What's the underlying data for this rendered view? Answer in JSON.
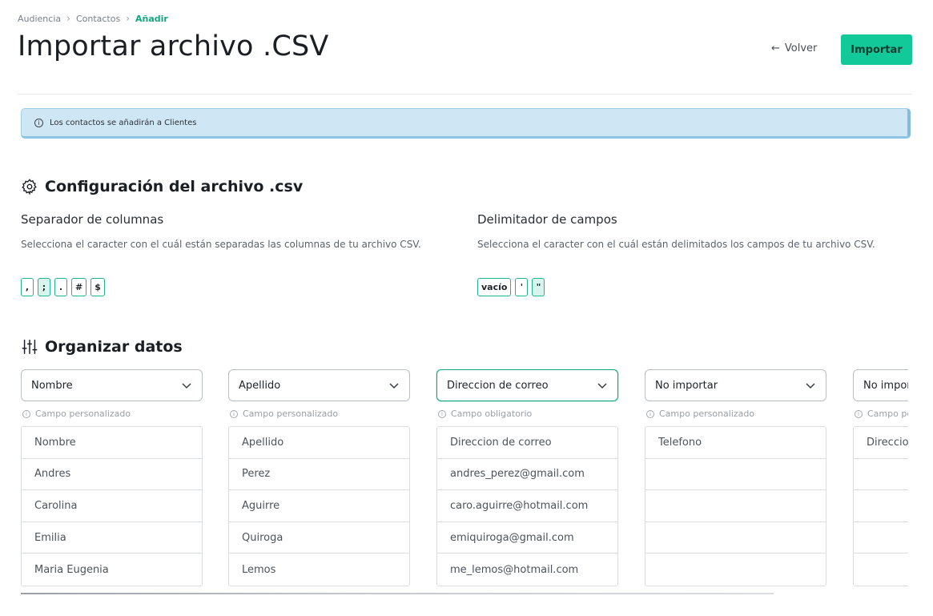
{
  "breadcrumb": [
    "Audiencia",
    "Contactos",
    "Añadir"
  ],
  "page_title": "Importar archivo .CSV",
  "actions": {
    "back_label": "Volver",
    "import_label": "Importar"
  },
  "alert": {
    "text": "Los contactos se añadirán a Clientes"
  },
  "config": {
    "title": "Configuración del archivo .csv",
    "separator": {
      "title": "Separador de columnas",
      "description": "Selecciona el caracter con el cuál están separadas las columnas de tu archivo CSV.",
      "options": [
        ",",
        ";",
        ".",
        "#",
        "$"
      ],
      "selected": ";"
    },
    "delimiter": {
      "title": "Delimitador de campos",
      "description": "Selecciona el caracter con el cuál están delimitados los campos de tu archivo CSV.",
      "options": [
        "vacío",
        "'",
        "\""
      ],
      "selected": "\""
    }
  },
  "organize": {
    "title": "Organizar datos",
    "columns": [
      {
        "field": "Nombre",
        "hint": "Campo personalizado",
        "cells": [
          "Nombre",
          "Andres",
          "Carolina",
          "Emilia",
          "Maria Eugenia"
        ]
      },
      {
        "field": "Apellido",
        "hint": "Campo personalizado",
        "cells": [
          "Apellido",
          "Perez",
          "Aguirre",
          "Quiroga",
          "Lemos"
        ]
      },
      {
        "field": "Direccion de correo",
        "hint": "Campo obligatorio",
        "cells": [
          "Direccion de correo",
          "andres_perez@gmail.com",
          "caro.aguirre@hotmail.com",
          "emiquiroga@gmail.com",
          "me_lemos@hotmail.com"
        ]
      },
      {
        "field": "No importar",
        "hint": "Campo personalizado",
        "cells": [
          "Telefono",
          "",
          "",
          "",
          ""
        ]
      },
      {
        "field": "No importar",
        "hint": "Campo personalizado",
        "cells": [
          "Direccion",
          "",
          "",
          "",
          ""
        ]
      }
    ]
  },
  "colors": {
    "accent": "#12c99a",
    "accent_text": "#13a67e",
    "alert_bg": "#cfe7f4"
  }
}
